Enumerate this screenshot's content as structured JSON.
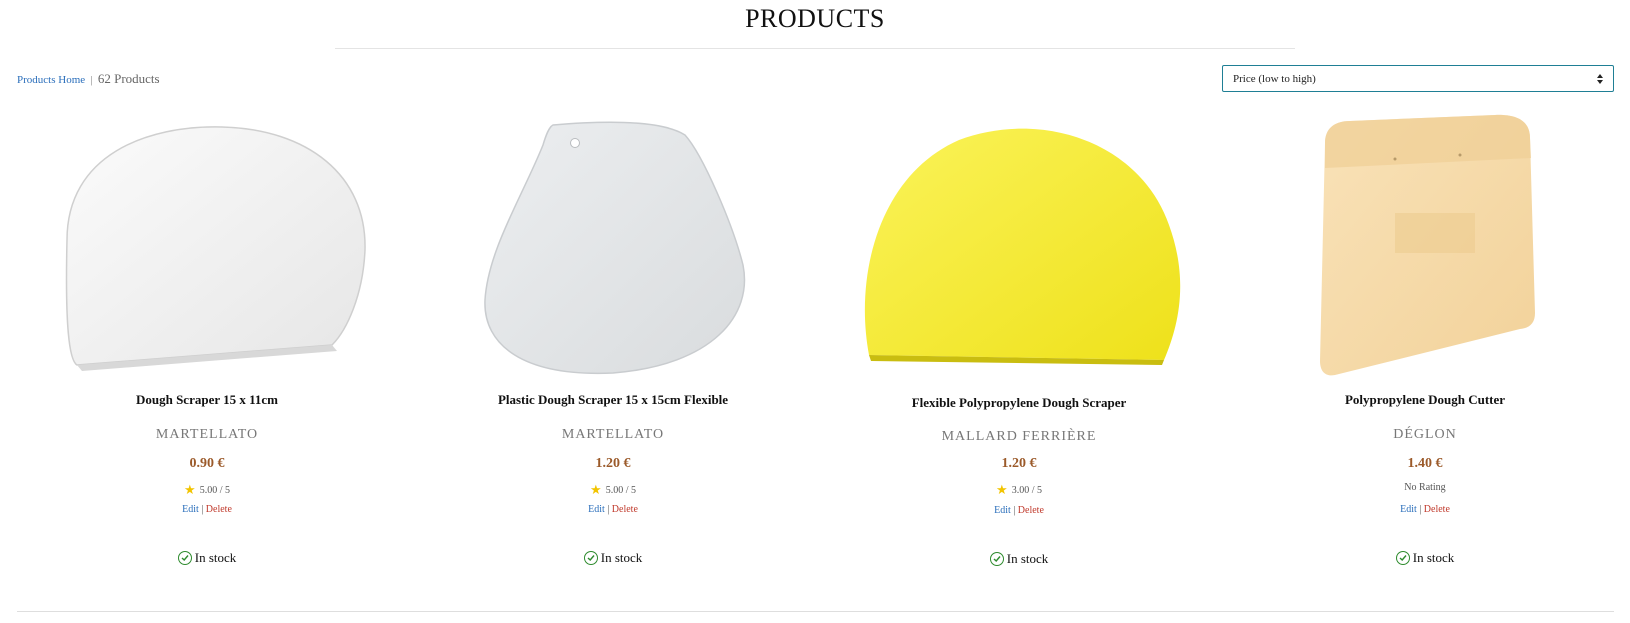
{
  "page": {
    "title": "PRODUCTS"
  },
  "breadcrumb": {
    "home_label": "Products Home",
    "separator": "|",
    "count_label": "62 Products"
  },
  "sort": {
    "selected": "Price (low to high)"
  },
  "products": [
    {
      "name": "Dough Scraper 15 x 11cm",
      "brand": "MARTELLATO",
      "price": "0.90 €",
      "rating": "5.00 / 5",
      "rating_icon": "star-icon",
      "edit_label": "Edit",
      "delete_label": "Delete",
      "stock": "In stock",
      "image_color": "#f2f2f2"
    },
    {
      "name": "Plastic Dough Scraper 15 x 15cm Flexible",
      "brand": "MARTELLATO",
      "price": "1.20 €",
      "rating": "5.00 / 5",
      "rating_icon": "star-icon",
      "edit_label": "Edit",
      "delete_label": "Delete",
      "stock": "In stock",
      "image_color": "#e3e6e8"
    },
    {
      "name": "Flexible Polypropylene Dough Scraper",
      "brand": "MALLARD FERRIÈRE",
      "price": "1.20 €",
      "rating": "3.00 / 5",
      "rating_icon": "star-icon",
      "edit_label": "Edit",
      "delete_label": "Delete",
      "stock": "In stock",
      "image_color": "#f7ee2a"
    },
    {
      "name": "Polypropylene Dough Cutter",
      "brand": "DÉGLON",
      "price": "1.40 €",
      "rating": "No Rating",
      "edit_label": "Edit",
      "delete_label": "Delete",
      "stock": "In stock",
      "image_color": "#f6dcae"
    }
  ],
  "colors": {
    "link": "#2a6ebb",
    "delete": "#c0392b",
    "price": "#9b5a2a",
    "stock_check": "#2e8b2e",
    "select_border": "#1f7f95"
  }
}
